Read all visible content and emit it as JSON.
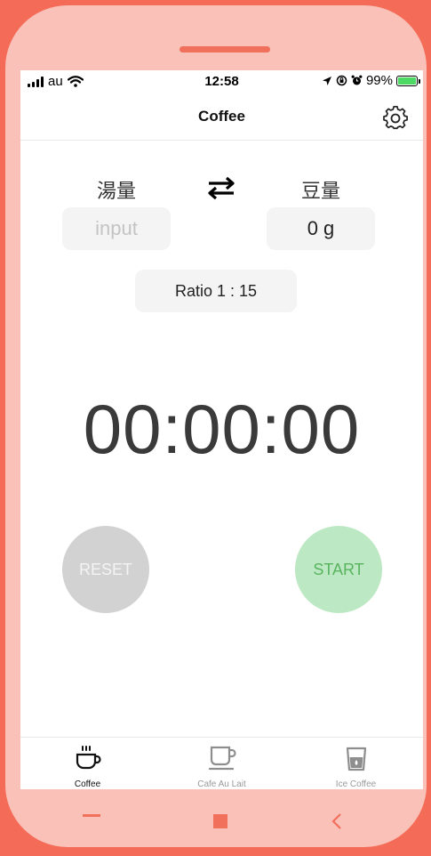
{
  "status_bar": {
    "carrier": "au",
    "time": "12:58",
    "battery_percent": "99%",
    "battery_color": "#4cd964"
  },
  "nav": {
    "title": "Coffee",
    "settings_icon": "gear-icon"
  },
  "converter": {
    "water_label": "湯量",
    "beans_label": "豆量",
    "swap_icon": "swap-arrows-icon",
    "water_input": {
      "value": "",
      "placeholder": "input"
    },
    "beans_value": "0 g",
    "ratio": "Ratio 1 : 15"
  },
  "timer": {
    "display": "00:00:00"
  },
  "buttons": {
    "reset_label": "RESET",
    "start_label": "START"
  },
  "tabs": [
    {
      "label": "Coffee",
      "icon": "coffee-cup-icon",
      "active": true
    },
    {
      "label": "Cafe Au Lait",
      "icon": "mug-icon",
      "active": false
    },
    {
      "label": "Ice Coffee",
      "icon": "iced-glass-icon",
      "active": false
    }
  ],
  "colors": {
    "frame_outer": "#f46b57",
    "frame_inner": "#f9c1b8",
    "start_bg": "#bce9c3",
    "start_text": "#59b35f",
    "reset_bg": "#d2d2d2",
    "tab_active": "#111111",
    "tab_inactive": "#9a9a9a"
  }
}
